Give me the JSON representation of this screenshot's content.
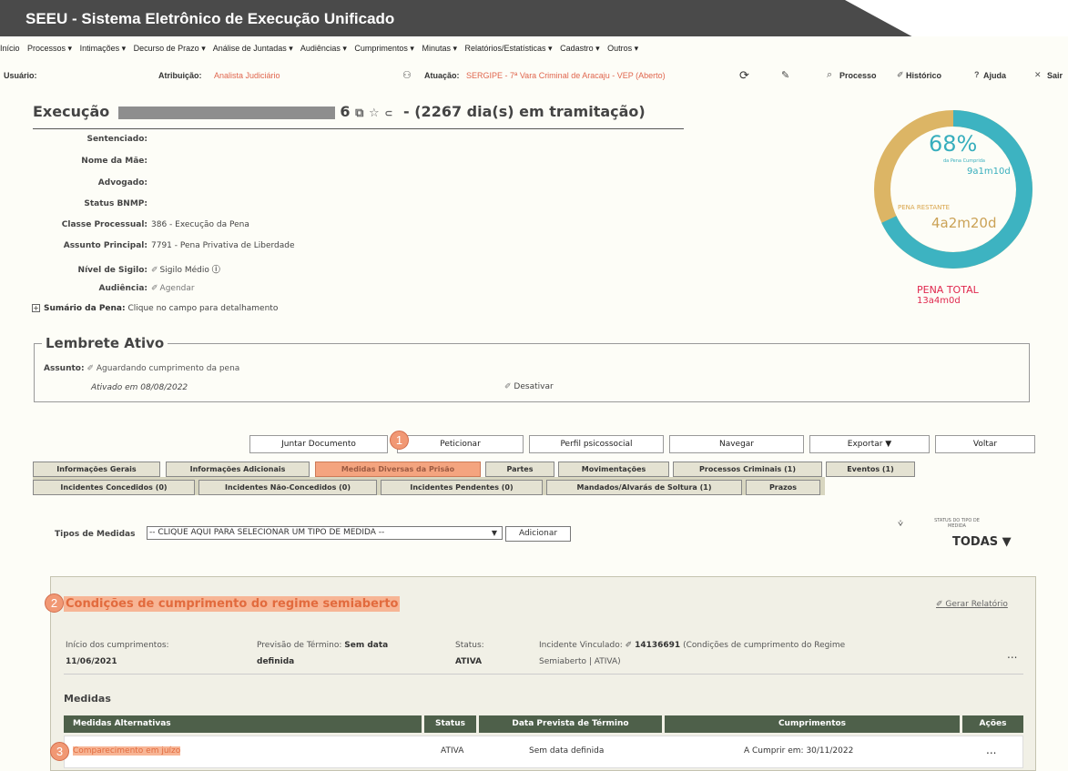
{
  "app": {
    "title": "SEEU - Sistema Eletrônico de Execução Unificado"
  },
  "menu": [
    "Início",
    "Processos ▾",
    "Intimações ▾",
    "Decurso de Prazo ▾",
    "Análise de Juntadas ▾",
    "Audiências ▾",
    "Cumprimentos ▾",
    "Minutas ▾",
    "Relatórios/Estatísticas ▾",
    "Cadastro ▾",
    "Outros ▾"
  ],
  "userbar": {
    "usuario": "Usuário:",
    "atribuicao_label": "Atribuição:",
    "atribuicao_value": "Analista Judiciário",
    "atuacao_label": "Atuação:",
    "atuacao_value": "SERGIPE - 7ª Vara Criminal de Aracaju - VEP (Aberto)",
    "processo": "Processo",
    "historico": "Histórico",
    "ajuda": "Ajuda",
    "sair": "Sair"
  },
  "execucao": {
    "label": "Execução",
    "id_tail": "6",
    "tramitacao": "-  (2267 dia(s) em tramitação)"
  },
  "fields": {
    "sentenciado": "Sentenciado:",
    "nome_mae": "Nome da Mãe:",
    "advogado": "Advogado:",
    "status_bnmp": "Status BNMP:",
    "classe_label": "Classe Processual:",
    "classe_value": "386 - Execução da Pena",
    "assunto_label": "Assunto Principal:",
    "assunto_value": "7791 - Pena Privativa de Liberdade",
    "sigilo_label": "Nível de Sigilo:",
    "sigilo_value": "Sigilo Médio",
    "audiencia_label": "Audiência:",
    "audiencia_value": "Agendar",
    "sumario_label": "Sumário da Pena:",
    "sumario_value": "Clique no campo para detalhamento"
  },
  "pena": {
    "percent": "68%",
    "percent_value": 68,
    "cumprida_label": "da Pena Cumprida",
    "cumprida_value": "9a1m10d",
    "restante_label": "PENA RESTANTE",
    "restante_value": "4a2m20d",
    "total_label": "PENA TOTAL",
    "total_value": "13a4m0d",
    "color_cumprida": "#3db3c1",
    "color_restante": "#dcb565"
  },
  "lembrete": {
    "title": "Lembrete Ativo",
    "assunto_label": "Assunto:",
    "assunto_value": "Aguardando cumprimento da pena",
    "ativado": "Ativado em 08/08/2022",
    "desativar": "Desativar"
  },
  "buttons": {
    "juntar": "Juntar Documento",
    "peticionar": "Peticionar",
    "perfil": "Perfil psicossocial",
    "navegar": "Navegar",
    "exportar": "Exportar ▼",
    "voltar": "Voltar"
  },
  "tabs_row1": [
    "Informações Gerais",
    "Informações Adicionais",
    "Medidas Diversas da Prisão",
    "Partes",
    "Movimentações",
    "Processos Criminais (1)",
    "Eventos (1)"
  ],
  "tabs_row2": [
    "Incidentes Concedidos (0)",
    "Incidentes Não-Concedidos (0)",
    "Incidentes Pendentes (0)",
    "Mandados/Alvarás de Soltura (1)",
    "Prazos"
  ],
  "tipos": {
    "label": "Tipos de Medidas",
    "selected": "-- CLIQUE AQUI PARA SELECIONAR UM TIPO DE MEDIDA --",
    "adicionar": "Adicionar"
  },
  "status_filter": {
    "label": "STATUS DO TIPO DE MEDIDA",
    "value": "TODAS ▼"
  },
  "condicoes": {
    "title": "Condições de cumprimento do regime semiaberto",
    "gerar": "Gerar Relatório",
    "inicio_label": "Início dos cumprimentos:",
    "inicio_value": "11/06/2021",
    "previsao_label": "Previsão de Término:",
    "previsao_value_1": "Sem data",
    "previsao_value_2": "definida",
    "status_label": "Status:",
    "status_value": "ATIVA",
    "incidente_label": "Incidente Vinculado:",
    "incidente_value_1": "14136691",
    "incidente_value_2": "(Condições de cumprimento do Regime",
    "incidente_value_3": "Semiaberto | ATIVA)",
    "more": "..."
  },
  "medidas": {
    "label": "Medidas",
    "headers": [
      "Medidas Alternativas",
      "Status",
      "Data Prevista de Término",
      "Cumprimentos",
      "Ações"
    ],
    "row": [
      "Comparecimento em juízo",
      "ATIVA",
      "Sem data definida",
      "A Cumprir em: 30/11/2022",
      "..."
    ]
  },
  "markers": [
    "1",
    "2",
    "3"
  ]
}
